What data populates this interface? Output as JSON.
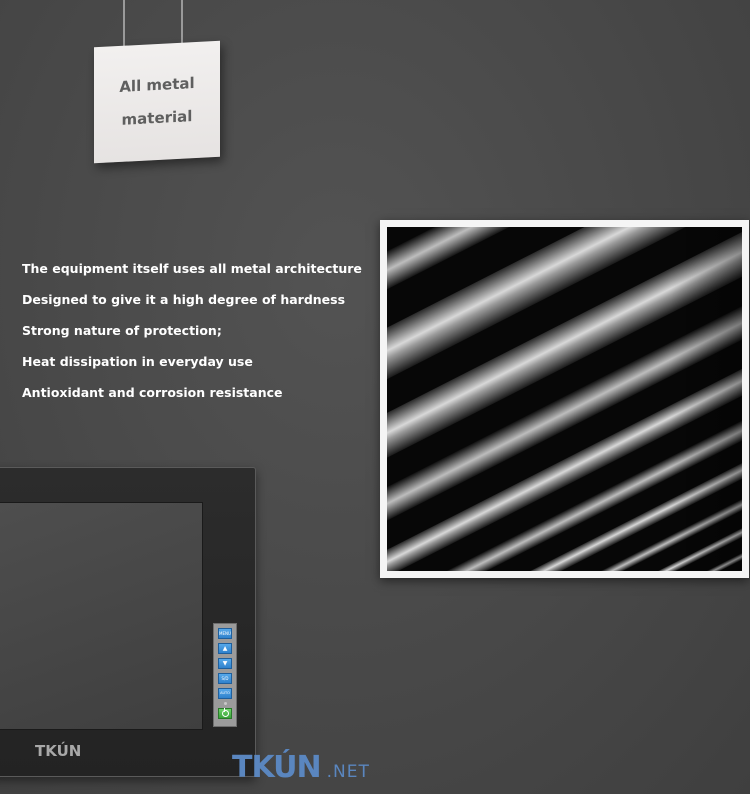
{
  "sign": {
    "lines": [
      "All metal",
      "material"
    ]
  },
  "features": [
    "The equipment itself uses all metal architecture",
    "Designed to give it a high degree of hardness",
    "Strong nature of protection;",
    "Heat dissipation in everyday use",
    "Antioxidant and corrosion resistance"
  ],
  "monitor": {
    "brand": "TKÚN",
    "buttons": [
      {
        "icon": "menu-icon",
        "label": "MENU"
      },
      {
        "icon": "arrow-up-icon",
        "label": "▲"
      },
      {
        "icon": "arrow-down-icon",
        "label": "▼"
      },
      {
        "icon": "source-icon",
        "label": "S/D"
      },
      {
        "icon": "auto-icon",
        "label": "AUTO"
      }
    ],
    "power_icon": "power-icon"
  },
  "footer": {
    "brand": "TKÚN",
    "tld": ".NET"
  },
  "colors": {
    "background": "#4a4a4a",
    "button_blue": "#3a8fd8",
    "power_green": "#4cb84a",
    "footer_blue": "#5a86bf"
  }
}
